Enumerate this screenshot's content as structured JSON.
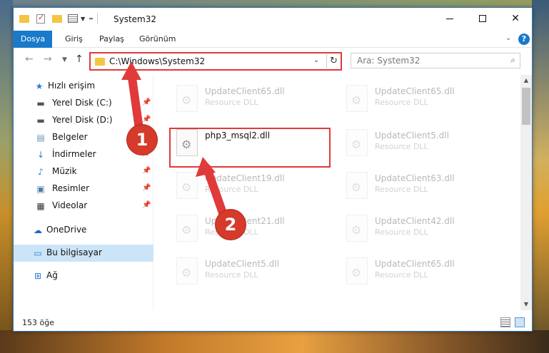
{
  "window": {
    "title": "System32",
    "controls": {
      "minimize": "",
      "maximize": "",
      "close": "✕"
    }
  },
  "ribbon": {
    "tabs": [
      "Dosya",
      "Giriş",
      "Paylaş",
      "Görünüm"
    ],
    "help": "?"
  },
  "navigation": {
    "path": "C:\\Windows\\System32",
    "search_placeholder": "Ara: System32"
  },
  "sidebar": {
    "items": [
      {
        "label": "Hızlı erişim",
        "icon": "star-icon",
        "pinned": false
      },
      {
        "label": "Yerel Disk (C:)",
        "icon": "drive-icon",
        "pinned": true
      },
      {
        "label": "Yerel Disk (D:)",
        "icon": "drive-icon",
        "pinned": true
      },
      {
        "label": "Belgeler",
        "icon": "documents-icon",
        "pinned": true
      },
      {
        "label": "İndirmeler",
        "icon": "download-icon",
        "pinned": true
      },
      {
        "label": "Müzik",
        "icon": "music-icon",
        "pinned": true
      },
      {
        "label": "Resimler",
        "icon": "pictures-icon",
        "pinned": true
      },
      {
        "label": "Videolar",
        "icon": "video-icon",
        "pinned": true
      },
      {
        "label": "OneDrive",
        "icon": "cloud-icon",
        "pinned": false
      },
      {
        "label": "Bu bilgisayar",
        "icon": "computer-icon",
        "pinned": false,
        "selected": true
      },
      {
        "label": "Ağ",
        "icon": "network-icon",
        "pinned": false
      }
    ]
  },
  "files": [
    {
      "name": "UpdateClient65.dll",
      "type": "Resource DLL",
      "faded": true
    },
    {
      "name": "UpdateClient65.dll",
      "type": "Resource DLL",
      "faded": true
    },
    {
      "name": "php3_msql2.dll",
      "type": "",
      "faded": false,
      "highlighted": true
    },
    {
      "name": "UpdateClient5.dll",
      "type": "Resource DLL",
      "faded": true
    },
    {
      "name": "UpdateClient19.dll",
      "type": "Resource DLL",
      "faded": true
    },
    {
      "name": "UpdateClient63.dll",
      "type": "Resource DLL",
      "faded": true
    },
    {
      "name": "UpdateClient21.dll",
      "type": "Resource DLL",
      "faded": true
    },
    {
      "name": "UpdateClient42.dll",
      "type": "Resource DLL",
      "faded": true
    },
    {
      "name": "UpdateClient5.dll",
      "type": "Resource DLL",
      "faded": true
    },
    {
      "name": "UpdateClient65.dll",
      "type": "Resource DLL",
      "faded": true
    }
  ],
  "status": {
    "item_count": "153 öğe"
  },
  "annotations": {
    "step1": "1",
    "step2": "2"
  },
  "colors": {
    "accent": "#1979ca",
    "highlight": "#e03a3a",
    "badge": "#d63a2a",
    "selected": "#cce4f7"
  }
}
